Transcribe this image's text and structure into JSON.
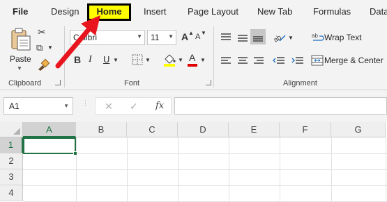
{
  "tabs": [
    {
      "label": "File"
    },
    {
      "label": "Design"
    },
    {
      "label": "Home"
    },
    {
      "label": "Insert"
    },
    {
      "label": "Page Layout"
    },
    {
      "label": "New Tab"
    },
    {
      "label": "Formulas"
    },
    {
      "label": "Data"
    }
  ],
  "clipboard": {
    "paste_label": "Paste",
    "group_label": "Clipboard"
  },
  "font": {
    "name_value": "Calibri",
    "size_value": "11",
    "bold": "B",
    "italic": "I",
    "underline": "U",
    "font_color_glyph": "A",
    "grow_glyph": "A",
    "shrink_glyph": "A",
    "group_label": "Font"
  },
  "alignment": {
    "wrap_text": "Wrap Text",
    "merge_center": "Merge & Center",
    "group_label": "Alignment"
  },
  "formula_bar": {
    "name_box": "A1",
    "cancel": "✕",
    "enter": "✓",
    "fx": "fx",
    "formula": ""
  },
  "grid": {
    "columns": [
      "A",
      "B",
      "C",
      "D",
      "E",
      "F",
      "G"
    ],
    "rows": [
      "1",
      "2",
      "3",
      "4"
    ],
    "active_cell": "A1"
  },
  "colors": {
    "highlight": "#ffff00",
    "font_red": "#e00000",
    "excel_green": "#217346",
    "arrow_red": "#e8141e"
  }
}
